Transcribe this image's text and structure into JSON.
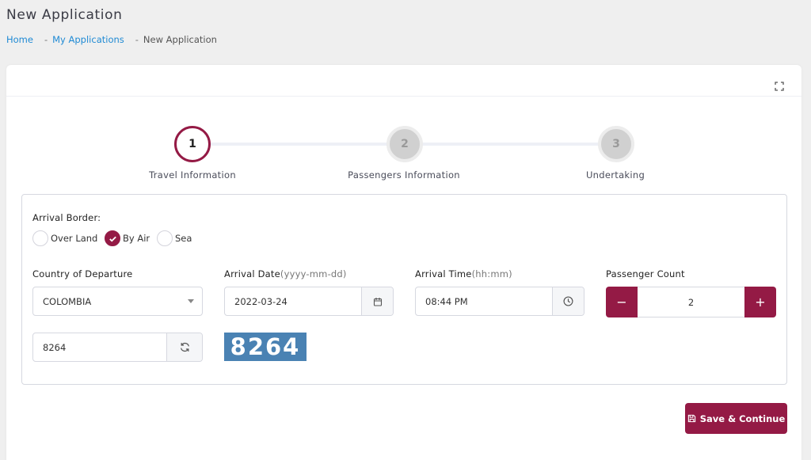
{
  "page": {
    "title": "New Application"
  },
  "breadcrumb": {
    "home": "Home",
    "parent": "My Applications",
    "current": "New Application",
    "separator": "-"
  },
  "stepper": {
    "steps": [
      {
        "number": "1",
        "label": "Travel Information",
        "state": "active"
      },
      {
        "number": "2",
        "label": "Passengers Information",
        "state": "inactive"
      },
      {
        "number": "3",
        "label": "Undertaking",
        "state": "inactive"
      }
    ]
  },
  "form": {
    "arrival_border": {
      "label": "Arrival Border:",
      "options": [
        "Over Land",
        "By Air",
        "Sea"
      ],
      "selected": "By Air"
    },
    "country": {
      "label": "Country of Departure",
      "value": "COLOMBIA"
    },
    "arrival_date": {
      "label": "Arrival Date",
      "hint": "(yyyy-mm-dd)",
      "value": "2022-03-24"
    },
    "arrival_time": {
      "label": "Arrival Time",
      "hint": "(hh:mm)",
      "value": "08:44 PM"
    },
    "passenger_count": {
      "label": "Passenger Count",
      "value": "2",
      "minus": "−",
      "plus": "+"
    },
    "captcha": {
      "input_value": "8264",
      "image_text": "8264"
    }
  },
  "actions": {
    "save_label": "Save & Continue"
  },
  "colors": {
    "accent": "#941a45",
    "link": "#1f8ad4",
    "captcha_bg": "#4a82b3"
  },
  "icons": [
    "fullscreen-icon",
    "check-icon",
    "caret-down-icon",
    "calendar-icon",
    "clock-icon",
    "refresh-icon",
    "save-icon"
  ]
}
